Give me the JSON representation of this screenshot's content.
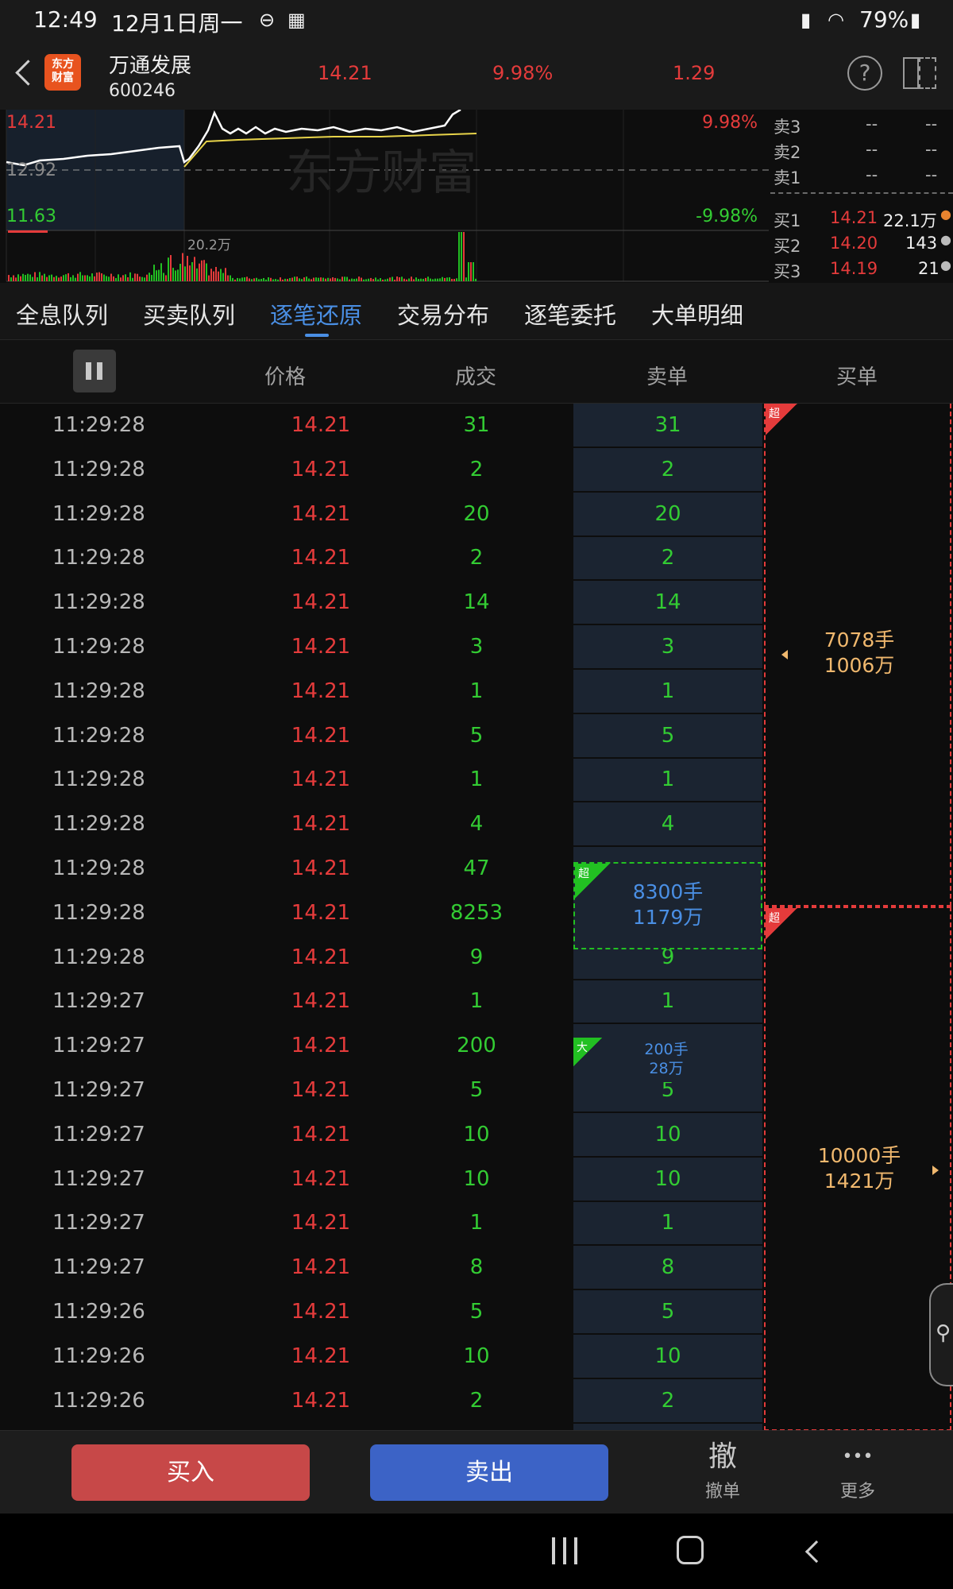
{
  "status_bar": {
    "time": "12:49",
    "date": "12月1日周一",
    "battery": "79%"
  },
  "header": {
    "logo_text_1": "东方",
    "logo_text_2": "财富",
    "stock_name": "万通发展",
    "stock_code": "600246",
    "price": "14.21",
    "change_pct": "9.98%",
    "change_amt": "1.29"
  },
  "chart": {
    "high_price": "14.21",
    "high_pct": "9.98%",
    "base_price": "12.92",
    "low_price": "11.63",
    "low_pct": "-9.98%",
    "volume_label": "20.2万",
    "watermark": "东方财富"
  },
  "order_book": {
    "asks": [
      {
        "label": "卖3",
        "price": "--",
        "vol": "--"
      },
      {
        "label": "卖2",
        "price": "--",
        "vol": "--"
      },
      {
        "label": "卖1",
        "price": "--",
        "vol": "--"
      }
    ],
    "bids": [
      {
        "label": "买1",
        "price": "14.21",
        "vol": "22.1万"
      },
      {
        "label": "买2",
        "price": "14.20",
        "vol": "143"
      },
      {
        "label": "买3",
        "price": "14.19",
        "vol": "21"
      }
    ]
  },
  "tabs": [
    "全息队列",
    "买卖队列",
    "逐笔还原",
    "交易分布",
    "逐笔委托",
    "大单明细"
  ],
  "active_tab": "逐笔还原",
  "columns": {
    "price": "价格",
    "volume": "成交",
    "sell": "卖单",
    "buy": "买单"
  },
  "rows": [
    {
      "time": "11:29:28",
      "price": "14.21",
      "vol": "31",
      "sell": "31"
    },
    {
      "time": "11:29:28",
      "price": "14.21",
      "vol": "2",
      "sell": "2"
    },
    {
      "time": "11:29:28",
      "price": "14.21",
      "vol": "20",
      "sell": "20"
    },
    {
      "time": "11:29:28",
      "price": "14.21",
      "vol": "2",
      "sell": "2"
    },
    {
      "time": "11:29:28",
      "price": "14.21",
      "vol": "14",
      "sell": "14"
    },
    {
      "time": "11:29:28",
      "price": "14.21",
      "vol": "3",
      "sell": "3"
    },
    {
      "time": "11:29:28",
      "price": "14.21",
      "vol": "1",
      "sell": "1"
    },
    {
      "time": "11:29:28",
      "price": "14.21",
      "vol": "5",
      "sell": "5"
    },
    {
      "time": "11:29:28",
      "price": "14.21",
      "vol": "1",
      "sell": "1"
    },
    {
      "time": "11:29:28",
      "price": "14.21",
      "vol": "4",
      "sell": "4"
    },
    {
      "time": "11:29:28",
      "price": "14.21",
      "vol": "47",
      "sell": ""
    },
    {
      "time": "11:29:28",
      "price": "14.21",
      "vol": "8253",
      "sell": ""
    },
    {
      "time": "11:29:28",
      "price": "14.21",
      "vol": "9",
      "sell": "9"
    },
    {
      "time": "11:29:27",
      "price": "14.21",
      "vol": "1",
      "sell": "1"
    },
    {
      "time": "11:29:27",
      "price": "14.21",
      "vol": "200",
      "sell": ""
    },
    {
      "time": "11:29:27",
      "price": "14.21",
      "vol": "5",
      "sell": "5"
    },
    {
      "time": "11:29:27",
      "price": "14.21",
      "vol": "10",
      "sell": "10"
    },
    {
      "time": "11:29:27",
      "price": "14.21",
      "vol": "10",
      "sell": "10"
    },
    {
      "time": "11:29:27",
      "price": "14.21",
      "vol": "1",
      "sell": "1"
    },
    {
      "time": "11:29:27",
      "price": "14.21",
      "vol": "8",
      "sell": "8"
    },
    {
      "time": "11:29:26",
      "price": "14.21",
      "vol": "5",
      "sell": "5"
    },
    {
      "time": "11:29:26",
      "price": "14.21",
      "vol": "10",
      "sell": "10"
    },
    {
      "time": "11:29:26",
      "price": "14.21",
      "vol": "2",
      "sell": "2"
    }
  ],
  "big_sells": [
    {
      "badge": "超",
      "qty": "8300手",
      "amount": "1179万"
    },
    {
      "badge": "大",
      "qty": "200手",
      "amount": "28万"
    }
  ],
  "big_buys": [
    {
      "badge": "超",
      "qty": "7078手",
      "amount": "1006万"
    },
    {
      "badge": "超",
      "qty": "10000手",
      "amount": "1421万"
    }
  ],
  "actions": {
    "buy": "买入",
    "sell": "卖出",
    "cancel_icon": "撤",
    "cancel_label": "撤单",
    "more_icon": "•••",
    "more_label": "更多"
  }
}
